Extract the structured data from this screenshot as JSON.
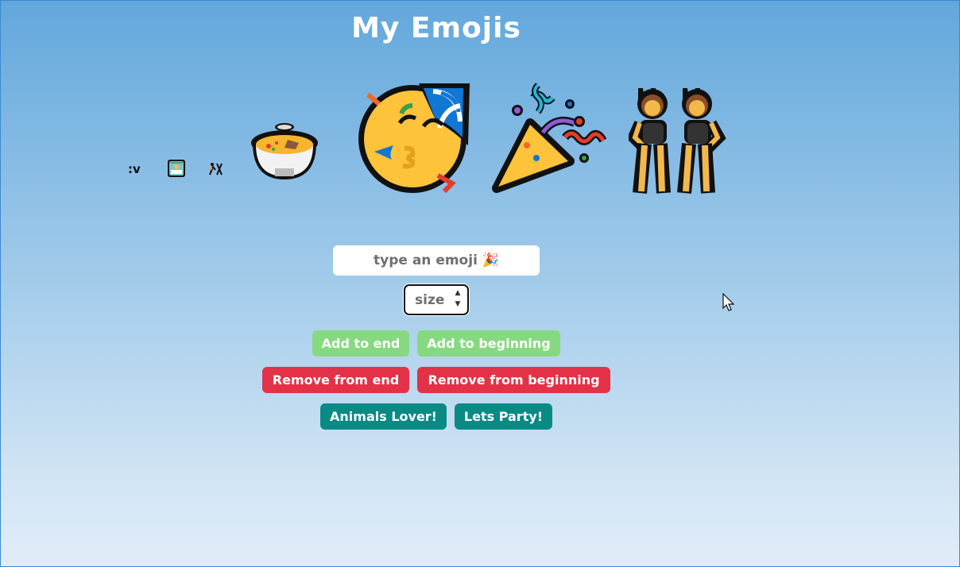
{
  "page": {
    "title": "My Emojis"
  },
  "emojis": {
    "items": [
      {
        "text": ":v",
        "size": "small"
      },
      {
        "text": "🏝",
        "size": "small"
      },
      {
        "text": "🎄",
        "size": "small"
      },
      {
        "icon": "stew-pot-icon",
        "size": "medium"
      },
      {
        "icon": "partying-face-icon",
        "size": "large"
      },
      {
        "icon": "party-popper-icon",
        "size": "large"
      },
      {
        "icon": "women-with-bunny-ears-icon",
        "size": "large"
      }
    ]
  },
  "form": {
    "emoji_input_placeholder": "type an emoji 🎉",
    "size_placeholder": "size"
  },
  "buttons": {
    "add_to_end": "Add to end",
    "add_to_beginning": "Add to beginning",
    "remove_from_end": "Remove from end",
    "remove_from_beginning": "Remove from beginning",
    "animals_lover": "Animals Lover!",
    "lets_party": "Lets Party!"
  },
  "colors": {
    "add_button": "#86d980",
    "remove_button": "#e33248",
    "preset_button": "#0a8a85",
    "background_top": "#62a7dc",
    "background_bottom": "#e0edf8"
  }
}
